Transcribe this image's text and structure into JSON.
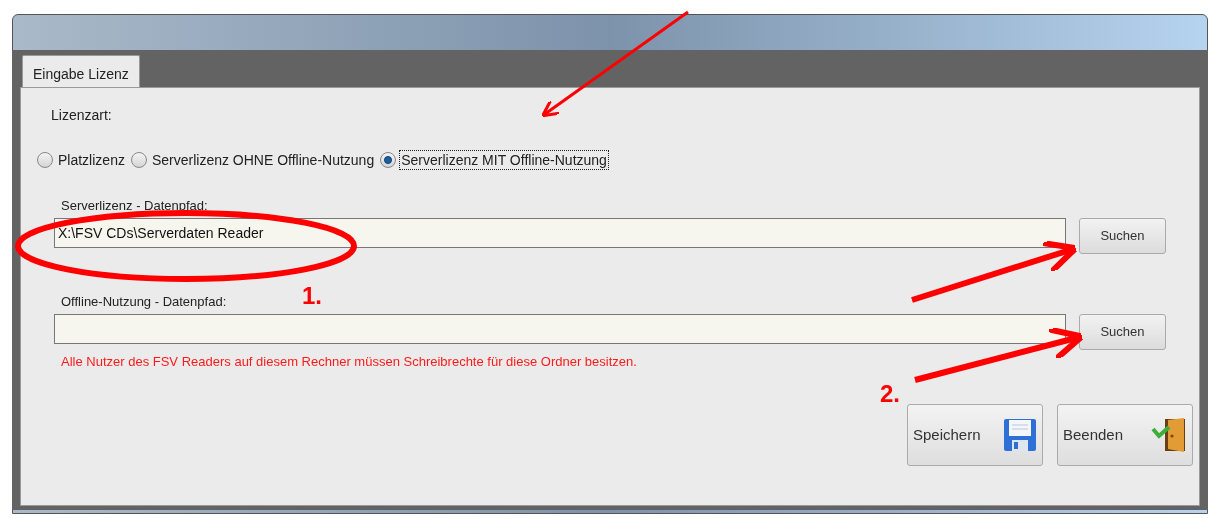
{
  "tabs": [
    {
      "label": "Eingabe Lizenz",
      "selected": true
    }
  ],
  "license_type": {
    "label": "Lizenzart:",
    "options": [
      {
        "label": "Platzlizenz",
        "selected": false
      },
      {
        "label": "Serverlizenz OHNE Offline-Nutzung",
        "selected": false
      },
      {
        "label": "Serverlizenz MIT Offline-Nutzung",
        "selected": true
      }
    ]
  },
  "paths": [
    {
      "label": "Serverlizenz - Datenpfad:",
      "value": "X:\\FSV CDs\\Serverdaten Reader",
      "button": "Suchen"
    },
    {
      "label": "Offline-Nutzung - Datenpfad:",
      "button": "Suchen"
    }
  ],
  "warning": "Alle Nutzer des FSV Readers auf diesem Rechner müssen Schreibrechte für diese Ordner besitzen.",
  "buttons": [
    {
      "kind": "save",
      "label": "Speichern"
    },
    {
      "kind": "exit",
      "label": "Beenden"
    }
  ],
  "annotations": [
    {
      "kind": "label",
      "text": "1."
    },
    {
      "kind": "label",
      "text": "2."
    }
  ]
}
